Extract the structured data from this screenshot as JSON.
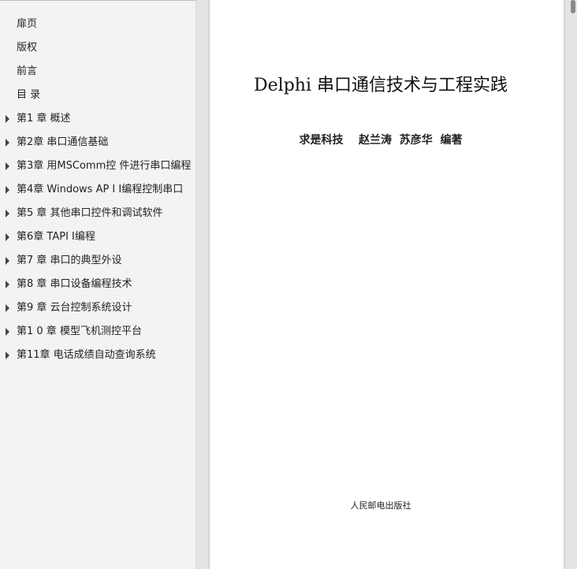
{
  "sidebar": {
    "items": [
      {
        "label": "扉页",
        "expandable": false
      },
      {
        "label": "版权",
        "expandable": false
      },
      {
        "label": "前言",
        "expandable": false
      },
      {
        "label": "目 录",
        "expandable": false
      },
      {
        "label": "第1 章 概述",
        "expandable": true
      },
      {
        "label": "第2章  串口通信基础",
        "expandable": true
      },
      {
        "label": "第3章 用MSComm控 件进行串口编程",
        "expandable": true
      },
      {
        "label": "第4章 Windows AP I I编程控制串口",
        "expandable": true
      },
      {
        "label": "第5 章 其他串口控件和调试软件",
        "expandable": true
      },
      {
        "label": "第6章 TAPI I编程",
        "expandable": true
      },
      {
        "label": "第7 章 串口的典型外设",
        "expandable": true
      },
      {
        "label": "第8 章 串口设备编程技术",
        "expandable": true
      },
      {
        "label": "第9 章 云台控制系统设计",
        "expandable": true
      },
      {
        "label": "第1 0 章 模型飞机测控平台",
        "expandable": true
      },
      {
        "label": "第11章  电话成绩自动查询系统",
        "expandable": true
      }
    ]
  },
  "page": {
    "title": "Delphi 串口通信技术与工程实践",
    "authors": "求是科技    赵兰涛  苏彦华  编著",
    "publisher": "人民邮电出版社"
  }
}
